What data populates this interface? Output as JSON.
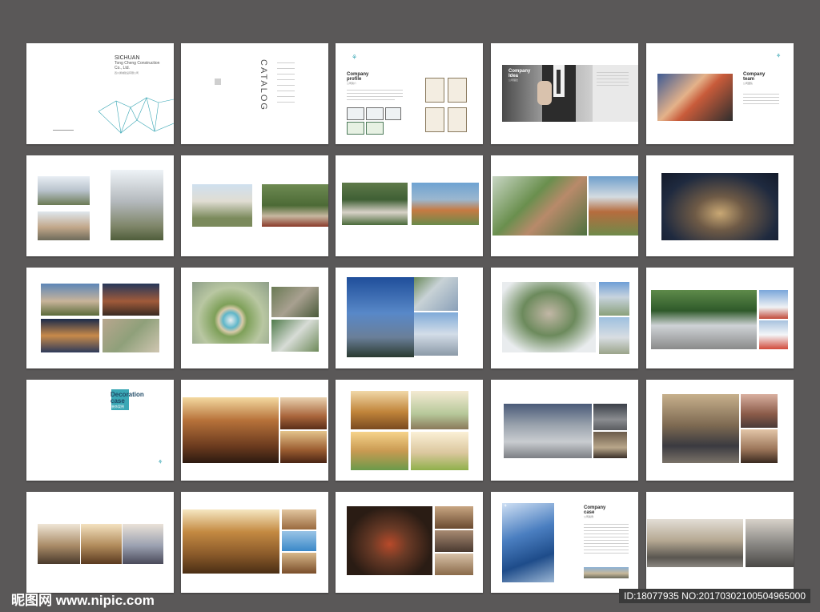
{
  "pages": {
    "cover": {
      "title": "SICHUAN",
      "subtitle_1": "Tong Cheng Construction",
      "subtitle_2": "Co., Ltd.",
      "chinese_name": "四川通诚建设有限公司"
    },
    "catalog": {
      "title": "CATALOG"
    },
    "profile": {
      "title_1": "Company",
      "title_2": "profile",
      "chinese": "公司简介"
    },
    "idea": {
      "title_1": "Company",
      "title_2": "Idea",
      "chinese": "公司理念"
    },
    "team": {
      "title_1": "Company",
      "title_2": "team",
      "chinese": "公司团队"
    },
    "decoration": {
      "title_1": "Decoration",
      "title_2": "case",
      "chinese": "装饰案例"
    },
    "case": {
      "title_1": "Company",
      "title_2": "case",
      "chinese": "公司案例"
    }
  },
  "footer": {
    "logo": "昵图网 www.nipic.com",
    "id": "ID:18077935 NO:20170302100504965000"
  },
  "colors": {
    "background": "#5a5858",
    "accent": "#3aa7b5"
  }
}
